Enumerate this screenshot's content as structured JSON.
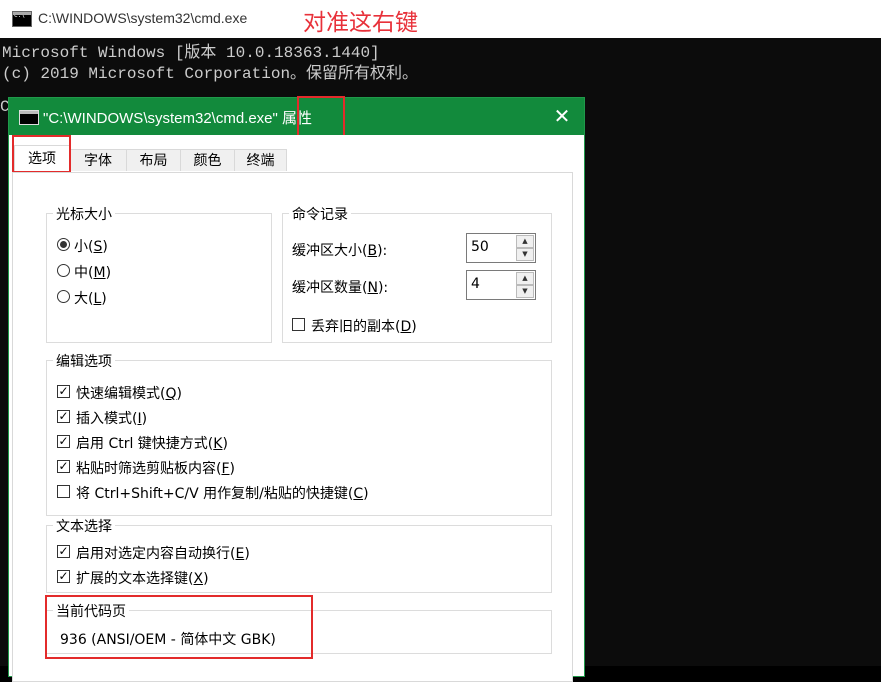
{
  "cmd": {
    "title": "C:\\WINDOWS\\system32\\cmd.exe",
    "annotation": "对准这右键",
    "lines": [
      "Microsoft Windows [版本 10.0.18363.1440]",
      "(c) 2019 Microsoft Corporation。保留所有权利。"
    ],
    "prompt_stub": "C"
  },
  "dialog": {
    "title": "\"C:\\WINDOWS\\system32\\cmd.exe\"",
    "title_suffix": "属性",
    "close": "✕",
    "tabs": [
      "选项",
      "字体",
      "布局",
      "颜色",
      "终端"
    ]
  },
  "cursor": {
    "title": "光标大小",
    "options": [
      {
        "label": "小(",
        "key": "S",
        "end": ")",
        "selected": true
      },
      {
        "label": "中(",
        "key": "M",
        "end": ")",
        "selected": false
      },
      {
        "label": "大(",
        "key": "L",
        "end": ")",
        "selected": false
      }
    ]
  },
  "history": {
    "title": "命令记录",
    "buffer_size": {
      "label": "缓冲区大小(",
      "key": "B",
      "end": "):",
      "value": "50"
    },
    "buffer_count": {
      "label": "缓冲区数量(",
      "key": "N",
      "end": "):",
      "value": "4"
    },
    "discard": {
      "label": "丢弃旧的副本(",
      "key": "D",
      "end": ")",
      "checked": false
    }
  },
  "edit": {
    "title": "编辑选项",
    "options": [
      {
        "label": "快速编辑模式(",
        "key": "Q",
        "end": ")",
        "checked": true
      },
      {
        "label": "插入模式(",
        "key": "I",
        "end": ")",
        "checked": true
      },
      {
        "label": "启用 Ctrl 键快捷方式(",
        "key": "K",
        "end": ")",
        "checked": true
      },
      {
        "label": "粘贴时筛选剪贴板内容(",
        "key": "F",
        "end": ")",
        "checked": true
      },
      {
        "label": "将 Ctrl+Shift+C/V 用作复制/粘贴的快捷键(",
        "key": "C",
        "end": ")",
        "checked": false
      }
    ]
  },
  "selection": {
    "title": "文本选择",
    "options": [
      {
        "label": "启用对选定内容自动换行(",
        "key": "E",
        "end": ")",
        "checked": true
      },
      {
        "label": "扩展的文本选择键(",
        "key": "X",
        "end": ")",
        "checked": true
      }
    ]
  },
  "codepage": {
    "title": "当前代码页",
    "value": "936   (ANSI/OEM - 简体中文 GBK)"
  },
  "colors": {
    "accent": "#128a3c",
    "highlight": "#e32b2b"
  }
}
